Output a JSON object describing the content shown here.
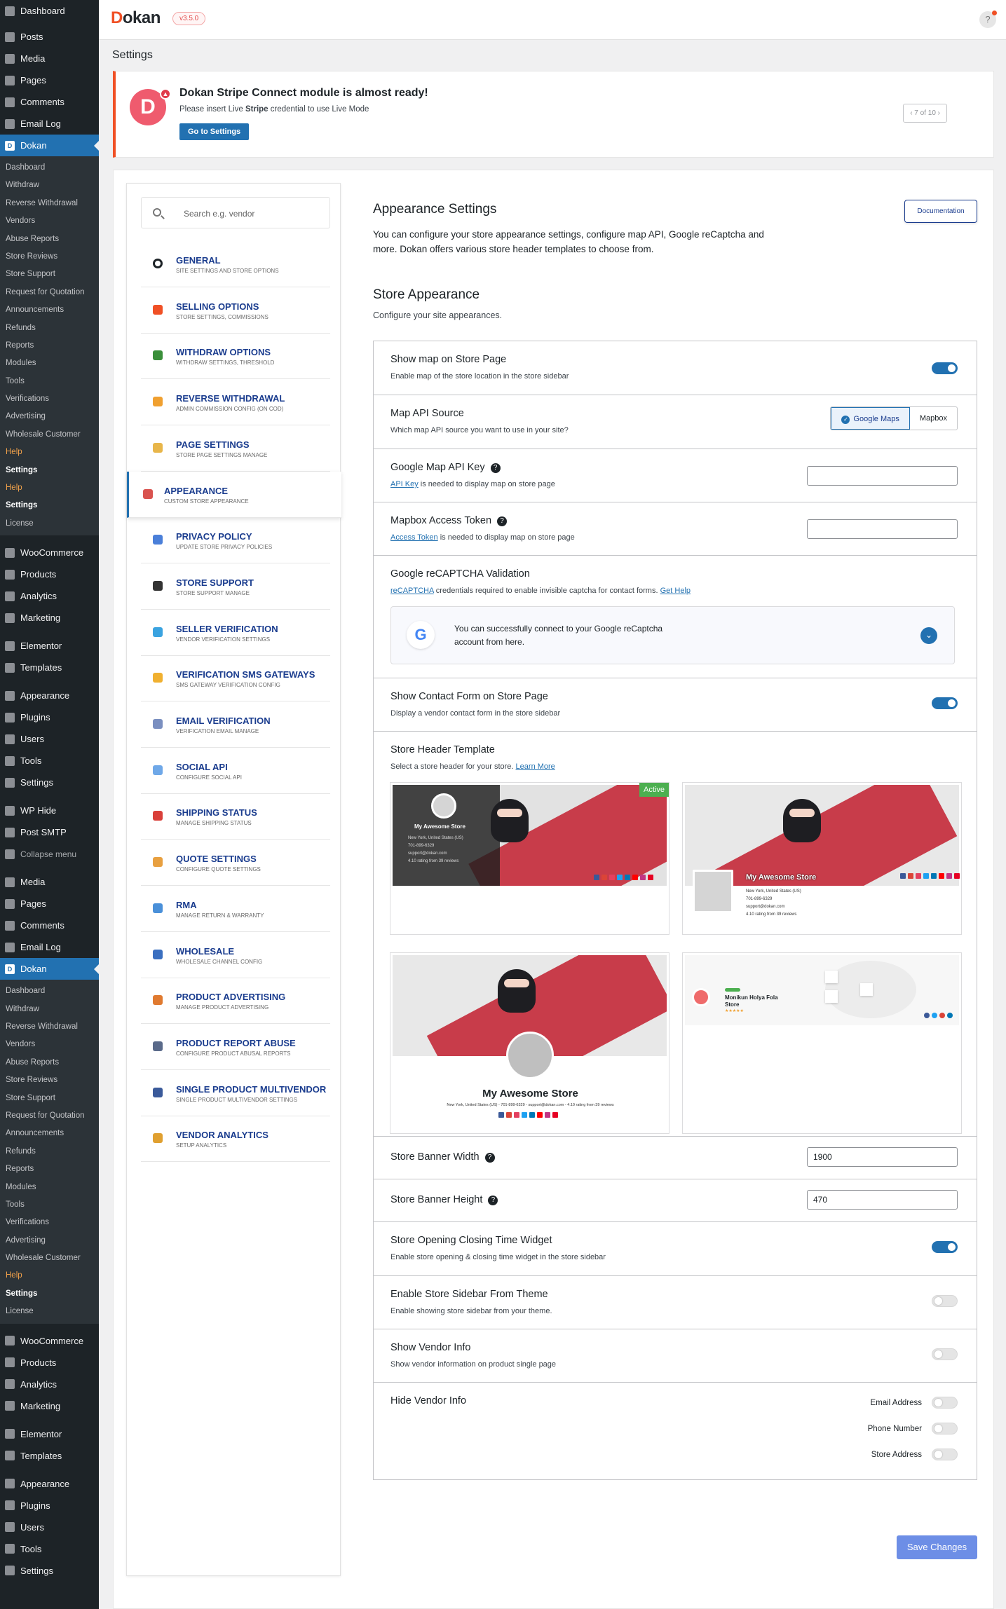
{
  "wp_menu": {
    "top": [
      {
        "label": "Dashboard",
        "icon": "dashboard-icon"
      },
      {
        "label": "Posts",
        "icon": "pin-icon"
      },
      {
        "label": "Media",
        "icon": "media-icon"
      },
      {
        "label": "Pages",
        "icon": "pages-icon"
      },
      {
        "label": "Comments",
        "icon": "comments-icon"
      },
      {
        "label": "Email Log",
        "icon": "email-icon"
      }
    ],
    "dokan_label": "Dokan",
    "dokan_sub": [
      "Dashboard",
      "Withdraw",
      "Reverse Withdrawal",
      "Vendors",
      "Abuse Reports",
      "Store Reviews",
      "Store Support",
      "Request for Quotation",
      "Announcements",
      "Refunds",
      "Reports",
      "Modules",
      "Tools",
      "Verifications",
      "Advertising",
      "Wholesale Customer",
      "Help",
      "Settings",
      "Help",
      "Settings",
      "License"
    ],
    "wc_group": [
      "WooCommerce",
      "Products",
      "Analytics",
      "Marketing"
    ],
    "el_group": [
      "Elementor",
      "Templates"
    ],
    "ap_group": [
      "Appearance",
      "Plugins",
      "Users",
      "Tools",
      "Settings"
    ],
    "extra_group": [
      "WP Hide",
      "Post SMTP"
    ],
    "collapse": "Collapse menu",
    "second_top": [
      "Media",
      "Pages",
      "Comments",
      "Email Log"
    ],
    "dokan_sub2": [
      "Dashboard",
      "Withdraw",
      "Reverse Withdrawal",
      "Vendors",
      "Abuse Reports",
      "Store Reviews",
      "Store Support",
      "Request for Quotation",
      "Announcements",
      "Refunds",
      "Reports",
      "Modules",
      "Tools",
      "Verifications",
      "Advertising",
      "Wholesale Customer",
      "Help",
      "Settings",
      "License"
    ],
    "wc_group2": [
      "WooCommerce",
      "Products",
      "Analytics",
      "Marketing"
    ],
    "el_group2": [
      "Elementor",
      "Templates"
    ],
    "ap_group2": [
      "Appearance",
      "Plugins",
      "Users",
      "Tools",
      "Settings"
    ]
  },
  "header": {
    "logo_d": "D",
    "logo_rest": "okan",
    "version": "v3.5.0",
    "help": "?"
  },
  "page_title": "Settings",
  "notice": {
    "badge": "▲",
    "title": "Dokan Stripe Connect module is almost ready!",
    "text_before": "Please insert Live ",
    "text_bold": "Stripe",
    "text_after": " credential to use Live Mode",
    "button": "Go to Settings",
    "pager": "‹  7 of 10  ›",
    "logo": "D"
  },
  "search_placeholder": "Search e.g. vendor",
  "nav": [
    {
      "title": "GENERAL",
      "sub": "SITE SETTINGS AND STORE OPTIONS",
      "color": "#1d2327"
    },
    {
      "title": "SELLING OPTIONS",
      "sub": "STORE SETTINGS, COMMISSIONS",
      "color": "#f05025"
    },
    {
      "title": "WITHDRAW OPTIONS",
      "sub": "WITHDRAW SETTINGS, THRESHOLD",
      "color": "#3a8f3a"
    },
    {
      "title": "REVERSE WITHDRAWAL",
      "sub": "ADMIN COMMISSION CONFIG (ON COD)",
      "color": "#f0a030"
    },
    {
      "title": "PAGE SETTINGS",
      "sub": "STORE PAGE SETTINGS MANAGE",
      "color": "#e8b64a"
    },
    {
      "title": "APPEARANCE",
      "sub": "CUSTOM STORE APPEARANCE",
      "color": "#d9534f"
    },
    {
      "title": "PRIVACY POLICY",
      "sub": "UPDATE STORE PRIVACY POLICIES",
      "color": "#4a7fd9"
    },
    {
      "title": "STORE SUPPORT",
      "sub": "STORE SUPPORT MANAGE",
      "color": "#333333"
    },
    {
      "title": "SELLER VERIFICATION",
      "sub": "VENDOR VERIFICATION SETTINGS",
      "color": "#3aa3e0"
    },
    {
      "title": "VERIFICATION SMS GATEWAYS",
      "sub": "SMS GATEWAY VERIFICATION CONFIG",
      "color": "#f0b030"
    },
    {
      "title": "EMAIL VERIFICATION",
      "sub": "VERIFICATION EMAIL MANAGE",
      "color": "#7a8fc0"
    },
    {
      "title": "SOCIAL API",
      "sub": "CONFIGURE SOCIAL API",
      "color": "#6fa8e8"
    },
    {
      "title": "SHIPPING STATUS",
      "sub": "MANAGE SHIPPING STATUS",
      "color": "#d9403a"
    },
    {
      "title": "QUOTE SETTINGS",
      "sub": "CONFIGURE QUOTE SETTINGS",
      "color": "#e8a040"
    },
    {
      "title": "RMA",
      "sub": "MANAGE RETURN & WARRANTY",
      "color": "#4a90d9"
    },
    {
      "title": "WHOLESALE",
      "sub": "WHOLESALE CHANNEL CONFIG",
      "color": "#3a6fc0"
    },
    {
      "title": "PRODUCT ADVERTISING",
      "sub": "MANAGE PRODUCT ADVERTISING",
      "color": "#e07a30"
    },
    {
      "title": "PRODUCT REPORT ABUSE",
      "sub": "CONFIGURE PRODUCT ABUSAL REPORTS",
      "color": "#5a6a8a"
    },
    {
      "title": "SINGLE PRODUCT MULTIVENDOR",
      "sub": "SINGLE PRODUCT MULTIVENDOR SETTINGS",
      "color": "#3a5a9a"
    },
    {
      "title": "VENDOR ANALYTICS",
      "sub": "SETUP ANALYTICS",
      "color": "#e0a030"
    }
  ],
  "content": {
    "title": "Appearance Settings",
    "doc_button": "Documentation",
    "intro": "You can configure your store appearance settings, configure map API, Google reCaptcha and more. Dokan offers various store header templates to choose from.",
    "section_title": "Store Appearance",
    "section_sub": "Configure your site appearances.",
    "show_map": {
      "label": "Show map on Store Page",
      "desc": "Enable map of the store location in the store sidebar",
      "on": true
    },
    "map_api": {
      "label": "Map API Source",
      "desc": "Which map API source you want to use in your site?",
      "opt1": "Google Maps",
      "opt2": "Mapbox",
      "check": "✓"
    },
    "gmap_key": {
      "label": "Google Map API Key",
      "link": "API Key",
      "desc": " is needed to display map on store page",
      "value": ""
    },
    "mapbox": {
      "label": "Mapbox Access Token",
      "link": "Access Token",
      "desc": " is needed to display map on store page",
      "value": ""
    },
    "recaptcha": {
      "label": "Google reCAPTCHA Validation",
      "link": "reCAPTCHA",
      "desc": " credentials required to enable invisible captcha for contact forms. ",
      "help": "Get Help",
      "box_text": "You can successfully connect to your Google reCaptcha account from here.",
      "g": "G",
      "chev": "⌄"
    },
    "contact_form": {
      "label": "Show Contact Form on Store Page",
      "desc": "Display a vendor contact form in the store sidebar",
      "on": true
    },
    "header_tpl": {
      "label": "Store Header Template",
      "desc": "Select a store header for your store. ",
      "link": "Learn More",
      "active": "Active",
      "t1_name": "My Awesome Store",
      "t1_addr": "New York, United States (US)",
      "t1_phone": "701-899-6329",
      "t1_email": "support@dokan.com",
      "t1_rating": "4.10 rating from 39 reviews",
      "t2_name": "My Awesome Store",
      "t2_addr": "New York, United States (US)",
      "t2_phone": "701-899-6329",
      "t2_email": "support@dokan.com",
      "t2_rating": "4.10 rating from 39 reviews",
      "t3_name": "My Awesome Store",
      "t3_line": "New York, United States (US) - 701-899-6329 - support@dokan.com - 4.10 rating from 39 reviews",
      "t4_name": "Monikun Holya Fola Store",
      "t4_stars": "★★★★★"
    },
    "banner_width": {
      "label": "Store Banner Width",
      "value": "1900"
    },
    "banner_height": {
      "label": "Store Banner Height",
      "value": "470"
    },
    "opening": {
      "label": "Store Opening Closing Time Widget",
      "desc": "Enable store opening & closing time widget in the store sidebar",
      "on": true
    },
    "sidebar": {
      "label": "Enable Store Sidebar From Theme",
      "desc": "Enable showing store sidebar from your theme.",
      "on": false
    },
    "vendor_info": {
      "label": "Show Vendor Info",
      "desc": "Show vendor information on product single page",
      "on": false
    },
    "hide_vendor": {
      "label": "Hide Vendor Info",
      "opt1": "Email Address",
      "opt2": "Phone Number",
      "opt3": "Store Address"
    },
    "save": "Save Changes"
  },
  "colors": {
    "accent": "#2271b1",
    "brand": "#f05025",
    "active": "#4caf50"
  }
}
